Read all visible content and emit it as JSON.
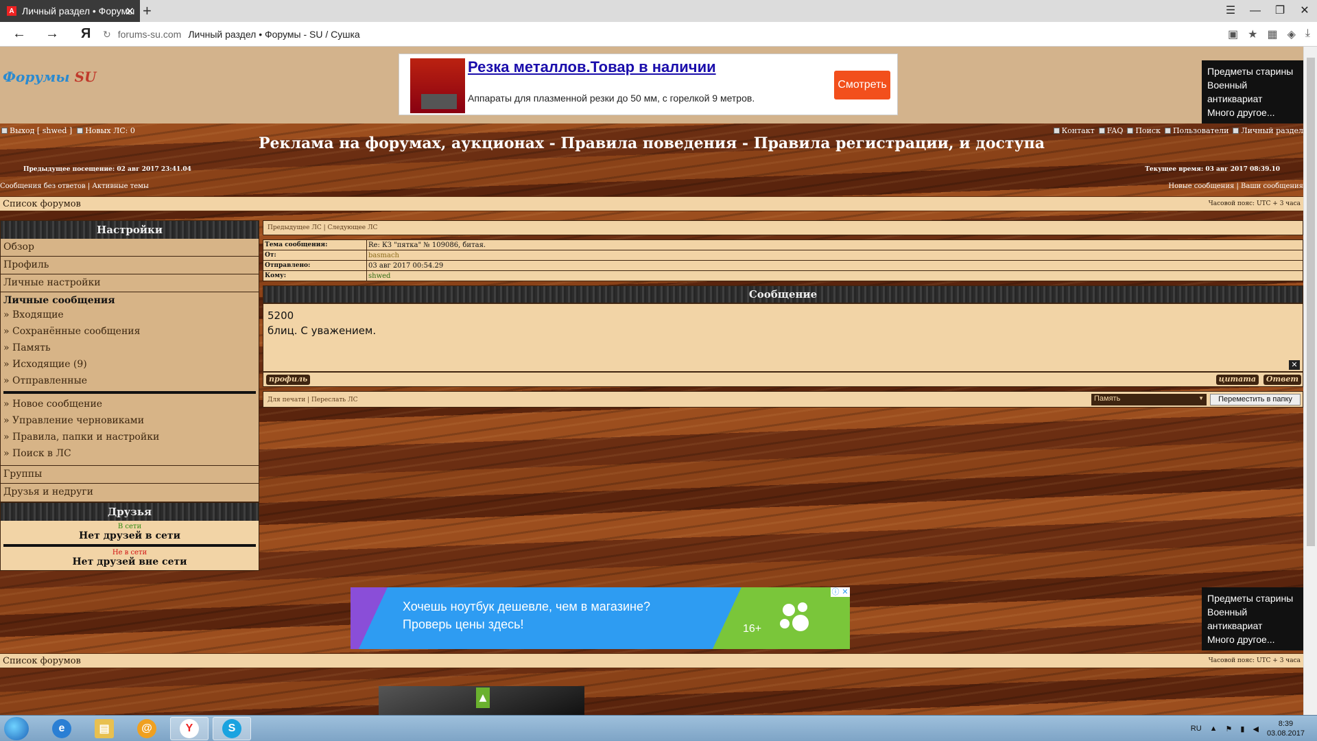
{
  "browser": {
    "tab_title": "Личный раздел • Форумы",
    "new_tab": "+",
    "domain": "forums-su.com",
    "page_title": "Личный раздел • Форумы - SU / Сушка"
  },
  "header": {
    "logo_main": "Форумы",
    "logo_su": "SU",
    "ad_top": {
      "title": "Резка металлов.Товар в наличии",
      "desc": "Аппараты для плазменной резки до 50 мм, с горелкой 9 метров.",
      "button": "Смотреть"
    },
    "side_ad": [
      "Предметы старины",
      "Военный антиквариат",
      "Много другое..."
    ]
  },
  "topbar": {
    "logout": "Выход [ shwed ]",
    "new_pm": "Новых ЛС: 0",
    "right_links": [
      "Контакт",
      "FAQ",
      "Поиск",
      "Пользователи",
      "Личный раздел"
    ],
    "site_title": "Реклама на форумах, аукционах - Правила поведения - Правила регистрации, и доступа",
    "prev_visit": "Предыдущее посещение: 02 авг 2017 23:41.04",
    "current_time": "Текущее время: 03 авг 2017 08:39.10",
    "links_left": "Сообщения без ответов | Активные темы",
    "links_right": "Новые сообщения | Ваши сообщения"
  },
  "forumbar": {
    "list": "Список форумов",
    "tz": "Часовой пояс: UTC + 3 часа"
  },
  "sidebar": {
    "header": "Настройки",
    "items": [
      "Обзор",
      "Профиль",
      "Личные настройки"
    ],
    "pm_title": "Личные сообщения",
    "pm_links": [
      "» Входящие",
      "» Сохранённые сообщения",
      "» Память",
      "» Исходящие (9)",
      "» Отправленные"
    ],
    "pm_links2": [
      "» Новое сообщение",
      "» Управление черновиками",
      "» Правила, папки и настройки",
      "» Поиск в ЛС"
    ],
    "items2": [
      "Группы",
      "Друзья и недруги"
    ],
    "friends_header": "Друзья",
    "online_label": "В сети",
    "online_none": "Нет друзей в сети",
    "offline_label": "Не в сети",
    "offline_none": "Нет друзей вне сети"
  },
  "message": {
    "nav": "Предыдущее ЛС | Следующее ЛС",
    "subject_label": "Тема сообщения:",
    "subject": "Re: КЗ \"пятка\" № 109086, битая.",
    "from_label": "От:",
    "from": "basmach",
    "sent_label": "Отправлено:",
    "sent": "03 авг 2017 00:54.29",
    "to_label": "Кому:",
    "to": "shwed",
    "header": "Сообщение",
    "body_line1": "5200",
    "body_line2": "блиц. С уважением.",
    "profile_btn": "профиль",
    "quote_btn": "цитата",
    "reply_btn": "Ответ",
    "print": "Для печати | Переслать ЛС",
    "folder_select": "Память",
    "move_btn": "Переместить в папку"
  },
  "ad_bottom": {
    "line1": "Хочешь ноутбук дешевле, чем в магазине?",
    "line2": "Проверь цены здесь!",
    "age": "16+"
  },
  "taskbar": {
    "lang": "RU",
    "time": "8:39",
    "date": "03.08.2017"
  },
  "colors": {
    "panel": "#f2d4a6",
    "panel_dark": "#d7b487",
    "wood": "#7a3a16"
  }
}
